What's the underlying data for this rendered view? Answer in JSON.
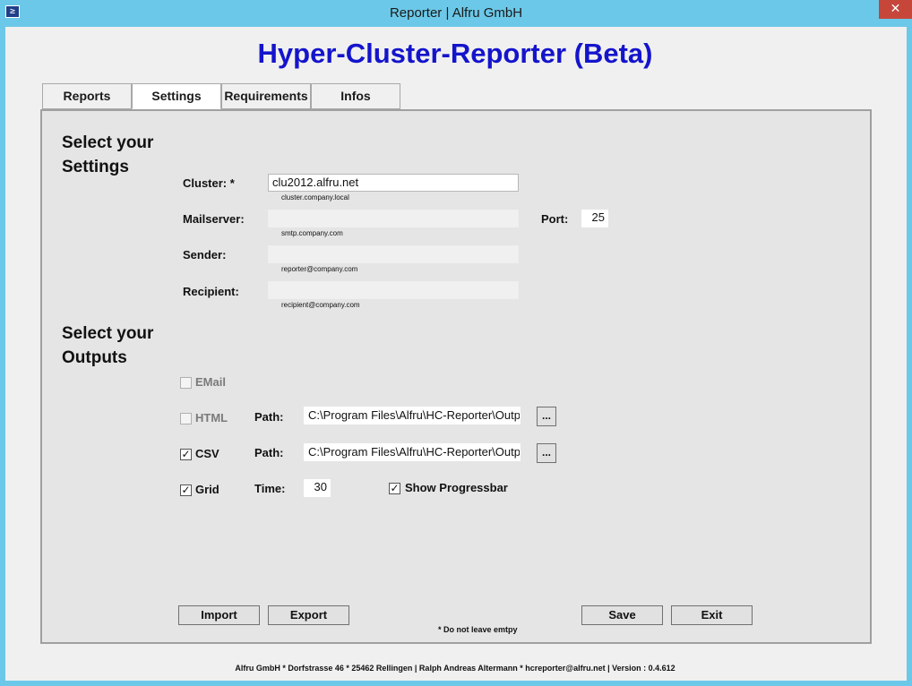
{
  "window": {
    "title": "Reporter | Alfru GmbH",
    "close_glyph": "✕",
    "icon_glyph": "≥",
    "icon_name": "powershell-icon"
  },
  "header": {
    "title": "Hyper-Cluster-Reporter (Beta)",
    "color": "#1414cc"
  },
  "tabs": [
    {
      "label": "Reports",
      "active": false
    },
    {
      "label": "Settings",
      "active": true
    },
    {
      "label": "Requirements",
      "active": false
    },
    {
      "label": "Infos",
      "active": false
    }
  ],
  "settings": {
    "section_title_line1": "Select your",
    "section_title_line2": "Settings",
    "cluster": {
      "label": "Cluster: *",
      "value": "clu2012.alfru.net",
      "hint": "cluster.company.local"
    },
    "mailserver": {
      "label": "Mailserver:",
      "value": "",
      "hint": "smtp.company.com"
    },
    "port": {
      "label": "Port:",
      "value": "25"
    },
    "sender": {
      "label": "Sender:",
      "value": "",
      "hint": "reporter@company.com"
    },
    "recipient": {
      "label": "Recipient:",
      "value": "",
      "hint": "recipient@company.com"
    }
  },
  "outputs": {
    "section_title_line1": "Select your",
    "section_title_line2": "Outputs",
    "email": {
      "label": "EMail",
      "checked": false,
      "enabled": false
    },
    "html": {
      "label": "HTML",
      "checked": false,
      "enabled": false,
      "path_label": "Path:",
      "path_value": "C:\\Program Files\\Alfru\\HC-Reporter\\Outp",
      "browse_label": "..."
    },
    "csv": {
      "label": "CSV",
      "checked": true,
      "enabled": true,
      "path_label": "Path:",
      "path_value": "C:\\Program Files\\Alfru\\HC-Reporter\\Outp",
      "browse_label": "..."
    },
    "grid": {
      "label": "Grid",
      "checked": true,
      "enabled": true,
      "time_label": "Time:",
      "time_value": "30"
    },
    "progressbar": {
      "label": "Show Progressbar",
      "checked": true
    }
  },
  "buttons": {
    "import_label": "Import",
    "export_label": "Export",
    "save_label": "Save",
    "exit_label": "Exit"
  },
  "required_note": "* Do not leave emtpy",
  "footer": "Alfru GmbH * Dorfstrasse 46 * 25462 Rellingen | Ralph Andreas Altermann * hcreporter@alfru.net | Version : 0.4.612"
}
